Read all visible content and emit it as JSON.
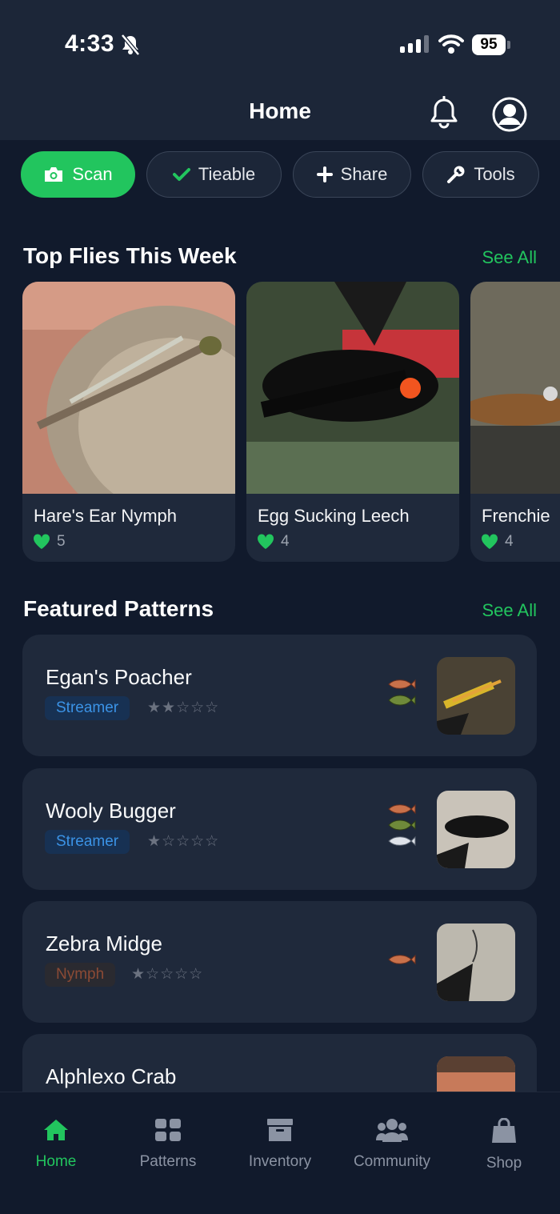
{
  "status": {
    "time": "4:33",
    "battery": "95"
  },
  "header": {
    "title": "Home"
  },
  "chips": [
    {
      "label": "Scan",
      "icon": "camera-icon"
    },
    {
      "label": "Tieable",
      "icon": "check-icon"
    },
    {
      "label": "Share",
      "icon": "plus-icon"
    },
    {
      "label": "Tools",
      "icon": "wrench-icon"
    }
  ],
  "top_flies": {
    "title": "Top Flies This Week",
    "see_all": "See All",
    "items": [
      {
        "name": "Hare's Ear Nymph",
        "likes": "5"
      },
      {
        "name": "Egg Sucking Leech",
        "likes": "4"
      },
      {
        "name": "Frenchie",
        "likes": "4"
      }
    ]
  },
  "featured": {
    "title": "Featured Patterns",
    "see_all": "See All",
    "items": [
      {
        "name": "Egan's Poacher",
        "type": "Streamer",
        "rating": 2,
        "stars": "★★☆☆☆"
      },
      {
        "name": "Wooly Bugger",
        "type": "Streamer",
        "rating": 1,
        "stars": "★☆☆☆☆"
      },
      {
        "name": "Zebra Midge",
        "type": "Nymph",
        "rating": 1,
        "stars": "★☆☆☆☆"
      },
      {
        "name": "Alphlexo Crab"
      }
    ]
  },
  "nav": [
    {
      "label": "Home",
      "icon": "home-icon"
    },
    {
      "label": "Patterns",
      "icon": "grid-icon"
    },
    {
      "label": "Inventory",
      "icon": "archive-box-icon"
    },
    {
      "label": "Community",
      "icon": "users-icon"
    },
    {
      "label": "Shop",
      "icon": "shopping-bag-icon"
    }
  ],
  "colors": {
    "accent": "#22c55e",
    "background": "#111a2c",
    "card": "#1f293b",
    "streamer_tag": "#3b93e6",
    "nymph_tag": "#8b4a35"
  }
}
